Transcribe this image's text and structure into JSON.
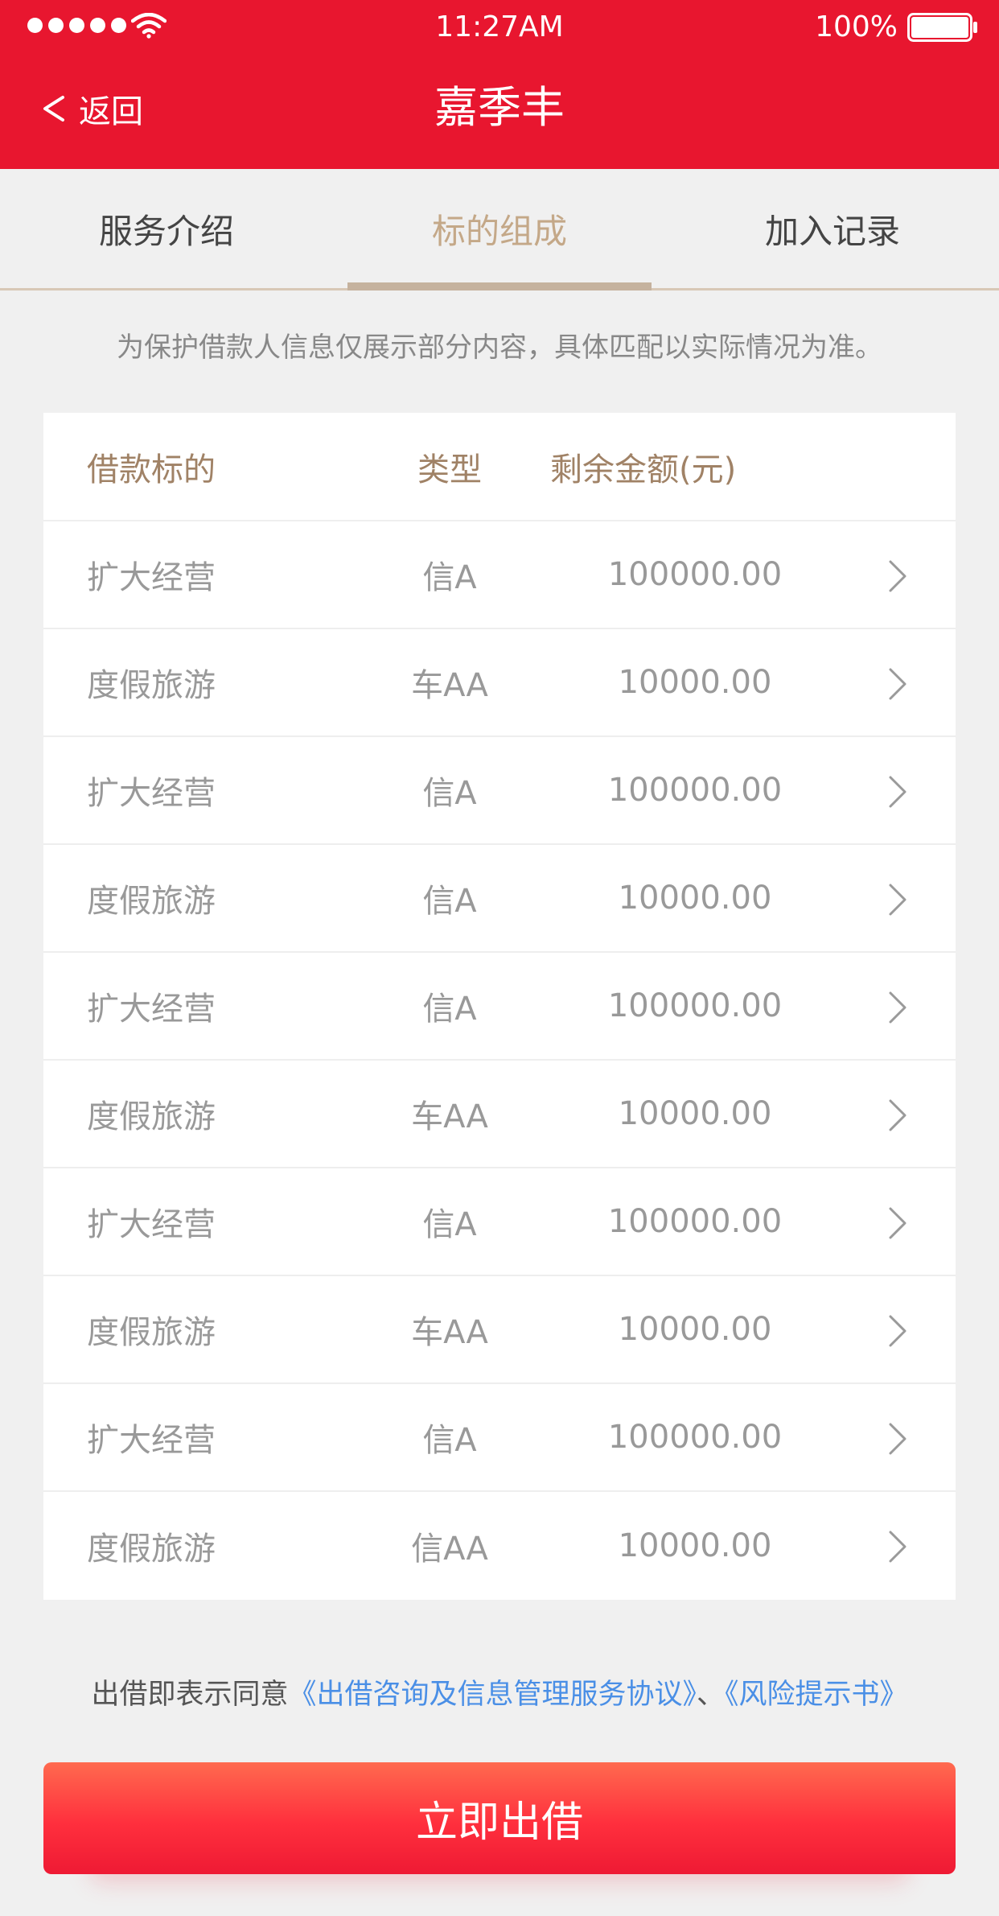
{
  "status_bar": {
    "time": "11:27AM",
    "battery_percent": "100%",
    "signal_dots": 5
  },
  "nav": {
    "back_label": "返回",
    "title": "嘉季丰"
  },
  "tabs": [
    {
      "label": "服务介绍",
      "active": false
    },
    {
      "label": "标的组成",
      "active": true
    },
    {
      "label": "加入记录",
      "active": false
    }
  ],
  "notice": "为保护借款人信息仅展示部分内容，具体匹配以实际情况为准。",
  "table": {
    "headers": {
      "purpose": "借款标的",
      "type": "类型",
      "amount": "剩余金额(元)"
    },
    "rows": [
      {
        "purpose": "扩大经营",
        "type": "信A",
        "amount": "100000.00"
      },
      {
        "purpose": "度假旅游",
        "type": "车AA",
        "amount": "10000.00"
      },
      {
        "purpose": "扩大经营",
        "type": "信A",
        "amount": "100000.00"
      },
      {
        "purpose": "度假旅游",
        "type": "信A",
        "amount": "10000.00"
      },
      {
        "purpose": "扩大经营",
        "type": "信A",
        "amount": "100000.00"
      },
      {
        "purpose": "度假旅游",
        "type": "车AA",
        "amount": "10000.00"
      },
      {
        "purpose": "扩大经营",
        "type": "信A",
        "amount": "100000.00"
      },
      {
        "purpose": "度假旅游",
        "type": "车AA",
        "amount": "10000.00"
      },
      {
        "purpose": "扩大经营",
        "type": "信A",
        "amount": "100000.00"
      },
      {
        "purpose": "度假旅游",
        "type": "信AA",
        "amount": "10000.00"
      }
    ]
  },
  "agreement": {
    "prefix": "出借即表示同意",
    "link1": "《出借咨询及信息管理服务协议》",
    "separator": "、",
    "link2": "《风险提示书》"
  },
  "submit_label": "立即出借",
  "colors": {
    "brand_red": "#e8162f",
    "tab_active": "#c4a888",
    "link_blue": "#4a8fe6"
  }
}
